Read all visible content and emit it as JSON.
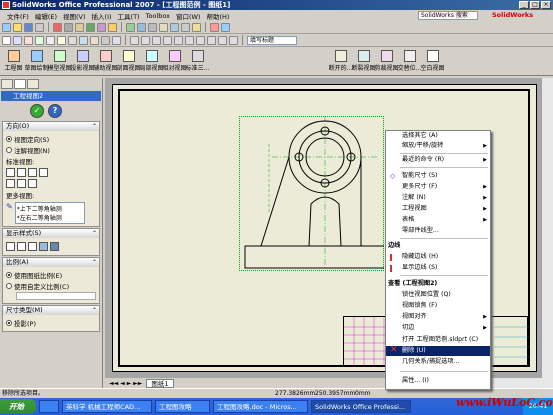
{
  "window": {
    "title": "SolidWorks Office Professional 2007 - [工程图范例 - 图纸1]",
    "help_search": "SolidWorks 搜索",
    "logo": "SolidWorks"
  },
  "menu": [
    "文件(F)",
    "编辑(E)",
    "视图(V)",
    "插入(I)",
    "工具(T)",
    "Toolbox",
    "窗口(W)",
    "帮助(H)"
  ],
  "toolbar": {
    "annotation_select": "填写标题"
  },
  "commands": [
    "工程图",
    "草图绘制",
    "模型视图",
    "投影视图",
    "辅助视图",
    "剖面视图",
    "局部视图",
    "相对视图",
    "标准三...",
    "断开的...",
    "断裂视图",
    "剪裁视图",
    "交替位...",
    "空白视图"
  ],
  "panel": {
    "header": "工程视图2",
    "sections": {
      "orientation": "方向(O)",
      "display_style": "显示样式(S)",
      "scale": "比例(A)",
      "dimension_type": "尺寸类型(M)"
    },
    "orientation_opts": [
      "视图定向(S)",
      "注解视图(N)"
    ],
    "standard_views_label": "标准视图:",
    "more_views_label": "更多视图:",
    "more_views": [
      "*上下二等角轴测",
      "*左右二等角轴测"
    ],
    "scale_opts": [
      "使用图纸比例(E)",
      "使用自定义比例(C)"
    ],
    "dim_opt": "投影(P)"
  },
  "sheet_tab": "图纸1",
  "status": {
    "text": "移除所选项目。",
    "x": "277.3826mm",
    "y": "250.3957mm",
    "z": "0mm"
  },
  "context_menu": {
    "items": [
      {
        "label": "选择其它 (A)",
        "sub": false
      },
      {
        "label": "缩放/平移/旋转",
        "sub": true
      },
      {
        "label": "最近的命令 (R)",
        "sub": true
      },
      {
        "label": "智能尺寸 (S)",
        "sub": false
      },
      {
        "label": "更多尺寸 (F)",
        "sub": true
      },
      {
        "label": "注解 (N)",
        "sub": true
      },
      {
        "label": "工程视图",
        "sub": true
      },
      {
        "label": "表格",
        "sub": true
      },
      {
        "label": "零部件线型...",
        "sub": false
      },
      {
        "label": "隐藏边线 (H)",
        "sub": false
      },
      {
        "label": "显示边线 (S)",
        "sub": false
      },
      {
        "label": "锁住视图位置 (Q)",
        "sub": false
      },
      {
        "label": "视图锁焦 (F)",
        "sub": false
      },
      {
        "label": "视图对齐",
        "sub": true
      },
      {
        "label": "切边",
        "sub": true
      },
      {
        "label": "打开 工程图范例.sldprt (C)",
        "sub": false
      },
      {
        "label": "删除 (U)",
        "sub": false
      },
      {
        "label": "几何关系/捕捉选项...",
        "sub": false
      },
      {
        "label": "属性... (I)",
        "sub": false
      }
    ],
    "head_edges": "边线",
    "head_view": "查看 (工程视图2)"
  },
  "taskbar": {
    "start": "开始",
    "tasks": [
      "英科学 机械工程师CAD...",
      "工程图攻略",
      "工程图攻略.doc - Micros...",
      "SolidWorks Office Professi..."
    ],
    "clock": "20:41"
  },
  "watermark": "www.iWuLoC.com"
}
